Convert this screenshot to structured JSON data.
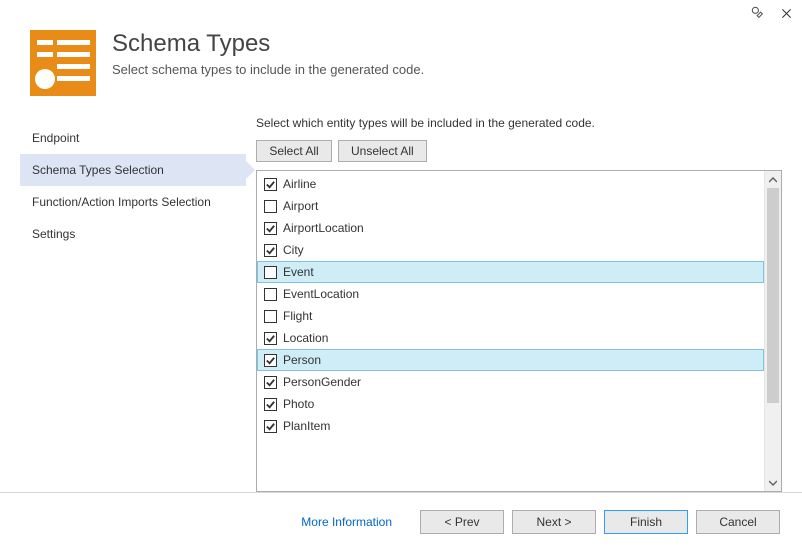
{
  "header": {
    "title": "Schema Types",
    "subtitle": "Select schema types to include in the generated code."
  },
  "sidebar": {
    "items": [
      {
        "label": "Endpoint",
        "selected": false
      },
      {
        "label": "Schema Types Selection",
        "selected": true
      },
      {
        "label": "Function/Action Imports Selection",
        "selected": false
      },
      {
        "label": "Settings",
        "selected": false
      }
    ]
  },
  "main": {
    "instruction": "Select which entity types will be included in the generated code.",
    "buttons": {
      "select_all": "Select All",
      "unselect_all": "Unselect All"
    },
    "entities": [
      {
        "label": "Airline",
        "checked": true,
        "highlight": false
      },
      {
        "label": "Airport",
        "checked": false,
        "highlight": false
      },
      {
        "label": "AirportLocation",
        "checked": true,
        "highlight": false
      },
      {
        "label": "City",
        "checked": true,
        "highlight": false
      },
      {
        "label": "Event",
        "checked": false,
        "highlight": true
      },
      {
        "label": "EventLocation",
        "checked": false,
        "highlight": false
      },
      {
        "label": "Flight",
        "checked": false,
        "highlight": false
      },
      {
        "label": "Location",
        "checked": true,
        "highlight": false
      },
      {
        "label": "Person",
        "checked": true,
        "highlight": true
      },
      {
        "label": "PersonGender",
        "checked": true,
        "highlight": false
      },
      {
        "label": "Photo",
        "checked": true,
        "highlight": false
      },
      {
        "label": "PlanItem",
        "checked": true,
        "highlight": false
      }
    ]
  },
  "footer": {
    "more_info": "More Information",
    "prev": "< Prev",
    "next": "Next >",
    "finish": "Finish",
    "cancel": "Cancel"
  }
}
